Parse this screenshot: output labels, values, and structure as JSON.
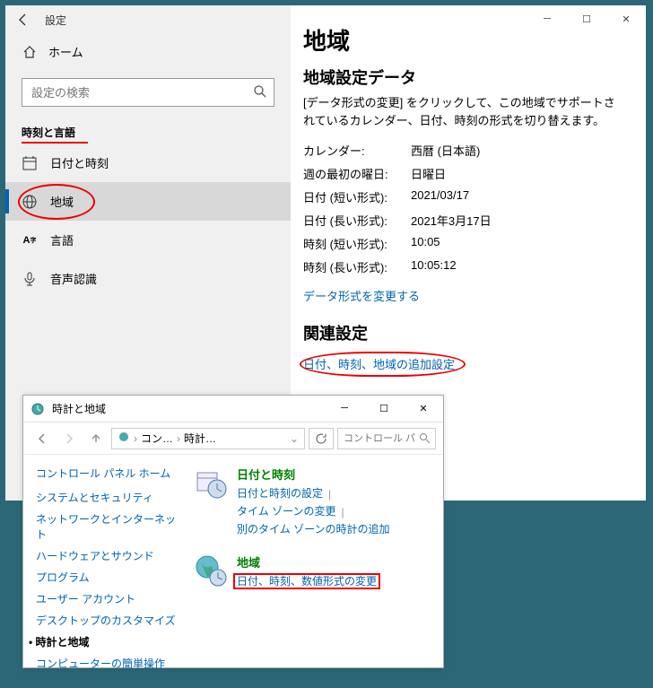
{
  "settings": {
    "window_title": "設定",
    "home": "ホーム",
    "search_placeholder": "設定の検索",
    "section": "時刻と言語",
    "nav": {
      "datetime": "日付と時刻",
      "region": "地域",
      "language": "言語",
      "speech": "音声認識"
    },
    "content": {
      "heading": "地域",
      "subheading": "地域設定データ",
      "desc": "[データ形式の変更] をクリックして、この地域でサポートされているカレンダー、日付、時刻の形式を切り替えます。",
      "rows": {
        "calendar_k": "カレンダー:",
        "calendar_v": "西暦 (日本語)",
        "firstday_k": "週の最初の曜日:",
        "firstday_v": "日曜日",
        "shortdate_k": "日付 (短い形式):",
        "shortdate_v": "2021/03/17",
        "longdate_k": "日付 (長い形式):",
        "longdate_v": "2021年3月17日",
        "shorttime_k": "時刻 (短い形式):",
        "shorttime_v": "10:05",
        "longtime_k": "時刻 (長い形式):",
        "longtime_v": "10:05:12"
      },
      "change_format_link": "データ形式を変更する",
      "related_heading": "関連設定",
      "related_link": "日付、時刻、地域の追加設定"
    }
  },
  "cp": {
    "title": "時計と地域",
    "crumb1": "コン…",
    "crumb2": "時計…",
    "search_placeholder": "コントロール パ…",
    "side": {
      "head": "コントロール パネル ホーム",
      "items": [
        "システムとセキュリティ",
        "ネットワークとインターネット",
        "ハードウェアとサウンド",
        "プログラム",
        "ユーザー アカウント",
        "デスクトップのカスタマイズ",
        "時計と地域",
        "コンピューターの簡単操作"
      ]
    },
    "cat1": {
      "title": "日付と時刻",
      "l1": "日付と時刻の設定",
      "l2": "タイム ゾーンの変更",
      "l3": "別のタイム ゾーンの時計の追加"
    },
    "cat2": {
      "title": "地域",
      "l1": "日付、時刻、数値形式の変更"
    }
  }
}
